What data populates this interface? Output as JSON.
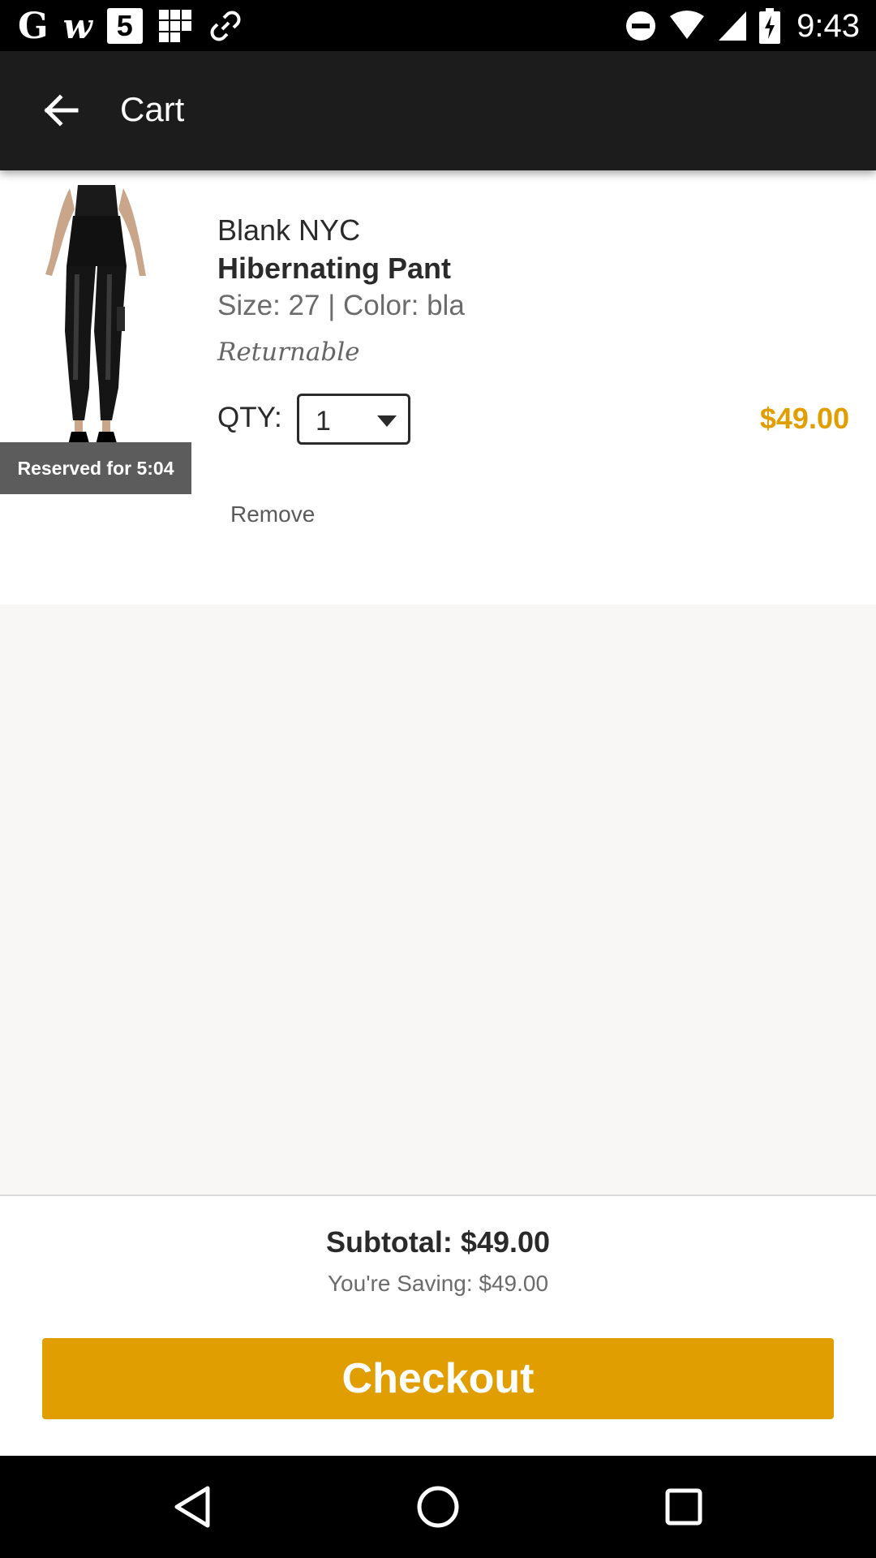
{
  "status_bar": {
    "time": "9:43",
    "left_icons": [
      "google-g-icon",
      "w-app-icon",
      "five-app-icon",
      "grid-app-icon",
      "link-app-icon"
    ],
    "right_icons": [
      "do-not-disturb-icon",
      "wifi-icon",
      "cell-signal-icon",
      "battery-charging-icon"
    ],
    "app_glyphs": {
      "google": "G",
      "w": "w",
      "five": "5"
    }
  },
  "app_bar": {
    "title": "Cart",
    "back_icon": "arrow-back-icon"
  },
  "cart_item": {
    "brand": "Blank NYC",
    "name": "Hibernating Pant",
    "meta": "Size: 27 | Color: bla",
    "returnable": "Returnable",
    "qty_label": "QTY:",
    "qty_value": "1",
    "price": "$49.00",
    "reserved": "Reserved for 5:04",
    "remove": "Remove"
  },
  "summary": {
    "subtotal": "Subtotal: $49.00",
    "saving": "You're Saving: $49.00",
    "checkout": "Checkout"
  },
  "colors": {
    "accent": "#e09e00",
    "app_bar": "#1c1c1c",
    "badge": "#5c5c5c",
    "background": "#f8f7f5"
  },
  "nav_bar": {
    "icons": [
      "nav-back-icon",
      "nav-home-icon",
      "nav-recents-icon"
    ]
  }
}
